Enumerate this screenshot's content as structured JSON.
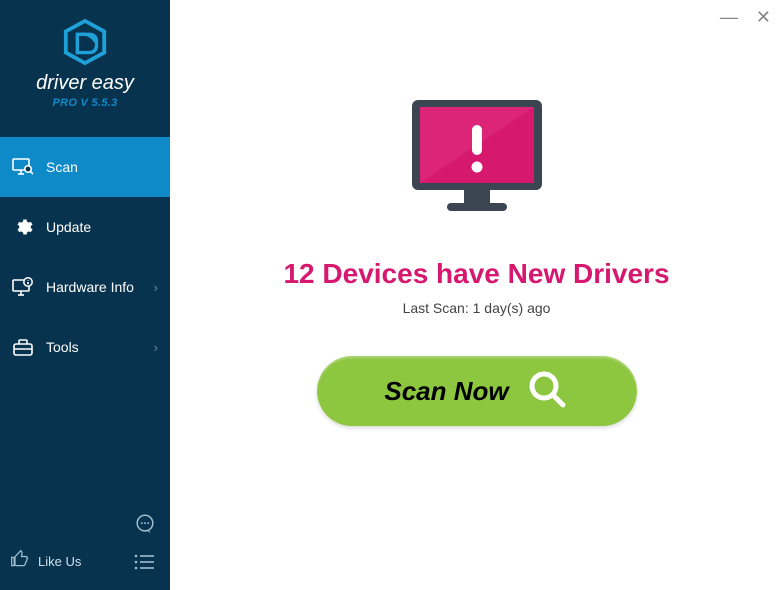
{
  "brand": {
    "name": "driver easy",
    "version": "PRO V 5.5.3"
  },
  "sidebar": {
    "items": [
      {
        "label": "Scan"
      },
      {
        "label": "Update"
      },
      {
        "label": "Hardware Info"
      },
      {
        "label": "Tools"
      }
    ],
    "like_label": "Like Us"
  },
  "main": {
    "headline": "12 Devices have New Drivers",
    "subline": "Last Scan: 1 day(s) ago",
    "scan_button_label": "Scan Now"
  }
}
